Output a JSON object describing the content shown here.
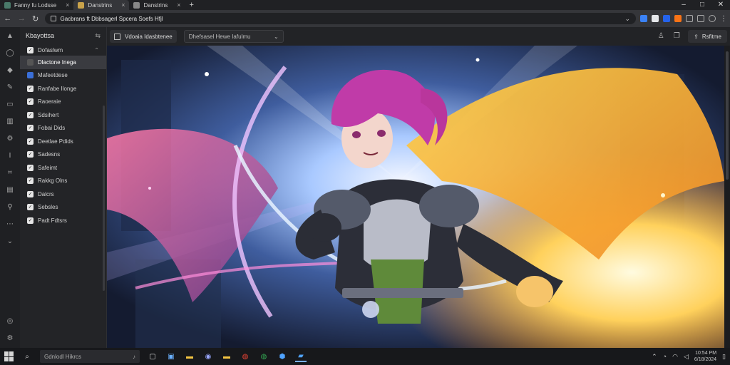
{
  "browser": {
    "tabs": [
      {
        "label": "Fanny fu Lodsse",
        "active": false
      },
      {
        "label": "Danstrins",
        "active": true
      }
    ],
    "window_controls": {
      "minimize": "–",
      "maximize": "□",
      "close": "✕"
    },
    "address": "Gacbrans ft Dbbsagerl Spcera Soefs Hfjl",
    "colors": {
      "tab_bg": "#202124",
      "toolbar_bg": "#35363a"
    }
  },
  "toolbar": {
    "project_button": "Vdoaia Idasbtenee",
    "preset_select": "Dhefsasel Hewe Iafulmu",
    "share_button": "Rsfitme"
  },
  "sidebar": {
    "title": "Kbayottsa",
    "group_label": "Dofaslwm",
    "items": [
      {
        "label": "Dlactone Inega",
        "check": "gray",
        "active": true
      },
      {
        "label": "Mafeetdese",
        "check": "blue",
        "active": false
      },
      {
        "label": "Ranfabe Ilonge",
        "check": "white",
        "active": false
      },
      {
        "label": "Raoeraie",
        "check": "white",
        "active": false
      },
      {
        "label": "Sdsihert",
        "check": "white",
        "active": false
      },
      {
        "label": "Fobai Dids",
        "check": "white",
        "active": false
      },
      {
        "label": "Deetlae Pdids",
        "check": "white",
        "active": false
      },
      {
        "label": "Sadesns",
        "check": "white",
        "active": false
      },
      {
        "label": "Safeimt",
        "check": "white",
        "active": false
      },
      {
        "label": "Rakkg Olns",
        "check": "white",
        "active": false
      },
      {
        "label": "Dalcrs",
        "check": "white",
        "active": false
      },
      {
        "label": "Sebsles",
        "check": "white",
        "active": false
      },
      {
        "label": "Padt Fdtsrs",
        "check": "white",
        "active": false
      }
    ]
  },
  "taskbar": {
    "search_placeholder": "Gdnlodl Hikrcs",
    "clock_time": "10:54 PM",
    "clock_date": "6/18/2024"
  }
}
